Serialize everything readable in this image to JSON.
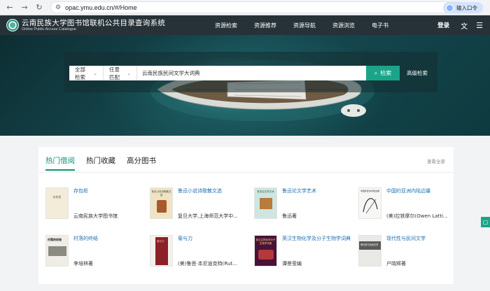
{
  "browser": {
    "url": "opac.ymu.edu.cn/#/Home",
    "login_chip": "输入口令"
  },
  "header": {
    "logo_cn": "云南民族大学图书馆联机公共目录查询系统",
    "logo_en": "Online Public Access Catalogue",
    "nav": [
      "资源检索",
      "资源推荐",
      "资源导航",
      "资源浏览",
      "电子书"
    ],
    "login": "登录",
    "lang_icon": "文",
    "menu_icon": "☰"
  },
  "search": {
    "field_select": "全部检索",
    "match_select": "任意匹配",
    "query": "云南民族民间文学大词典",
    "button": "检索",
    "advanced": "高级检索"
  },
  "books_panel": {
    "tabs": [
      "热门借阅",
      "热门收藏",
      "高分图书"
    ],
    "active_tab": 0,
    "view_all": "查看全部",
    "items": [
      {
        "title": "存包柜",
        "author": "云南民族大学图书馆",
        "cover_text": "存包柜"
      },
      {
        "title": "鲁迅小说诗歌散文选",
        "author": "复旦大学,上海师范大学中...",
        "cover_text": "鲁迅小说诗歌散文选"
      },
      {
        "title": "鲁迅论文学艺术",
        "author": "鲁迅著",
        "cover_text": "鲁迅论文学艺术"
      },
      {
        "title": "中国的亚洲内陆边疆",
        "author": "(美)拉铁摩尔(Owen Latti...",
        "cover_text": "中国的亚洲内陆边疆"
      },
      {
        "title": "村落的终结",
        "author": "李培林著",
        "cover_text": "村落的终结"
      },
      {
        "title": "菊与刀",
        "author": "(美)鲁思·本尼迪克特(Rut...",
        "cover_text": "菊与刀"
      },
      {
        "title": "英汉生物化学及分子生物学词典",
        "author": "谭景莹编",
        "cover_text": "英汉生物化学分子生物学词典"
      },
      {
        "title": "现代性与民间文学",
        "author": "户晓辉著",
        "cover_text": "现代性与民间文学"
      }
    ]
  },
  "colors": {
    "accent": "#1aa58a",
    "header_bg": "#263238",
    "link": "#1f6fb2"
  }
}
